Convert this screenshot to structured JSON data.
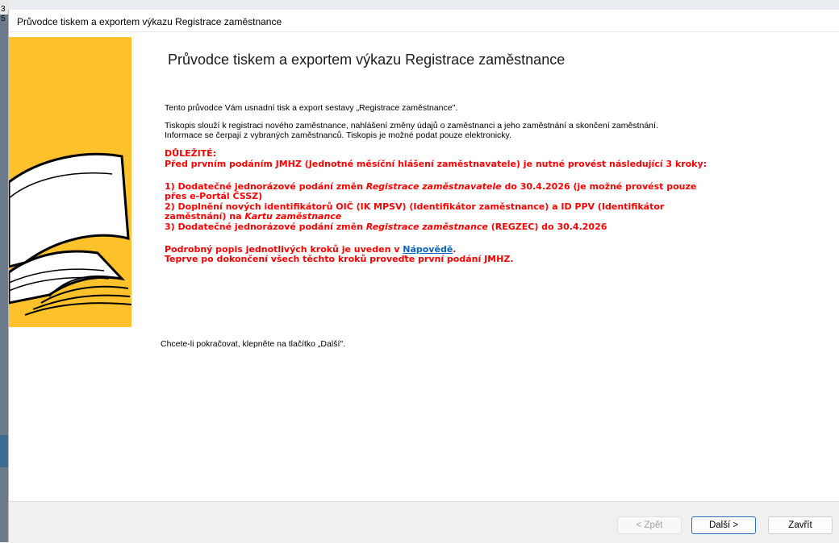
{
  "window": {
    "title": "Průvodce tiskem a exportem výkazu Registrace zaměstnance"
  },
  "background_chars": "3\n5",
  "wizard": {
    "heading": "Průvodce tiskem a exportem výkazu Registrace zaměstnance",
    "intro1": "Tento průvodce Vám usnadní tisk a export sestavy „Registrace zaměstnance\".",
    "intro2": "Tiskopis slouží k registraci nového zaměstnance, nahlášení změny údajů o zaměstnanci a jeho zaměstnání a skončení zaměstnání.",
    "intro3": "Informace se čerpají z vybraných zaměstnanců. Tiskopis je možné podat pouze elektronicky.",
    "important_label": "DŮLEŽITÉ:",
    "important_line": "Před prvním podáním JMHZ (Jednotné měsíční hlášení zaměstnavatele) je nutné provést následující 3 kroky:",
    "step1_a": "1) Dodatečné jednorázové podání změn ",
    "step1_italic": "Registrace zaměstnavatele",
    "step1_b": " do 30.4.2026 (je možné provést pouze",
    "step1_c": "přes e-Portál ČSSZ)",
    "step2_a": "2) Doplnění nových identifikátorů OIČ (IK MPSV) (Identifikátor zaměstnance) a ID PPV (Identifikátor",
    "step2_b": "zaměstnání) na ",
    "step2_italic": "Kartu zaměstnance",
    "step3_a": "3) Dodatečné jednorázové podání změn ",
    "step3_italic": "Registrace zaměstnance",
    "step3_b": " (REGZEC) do 30.4.2026",
    "help_a": "Podrobný popis jednotlivých kroků je uveden v ",
    "help_link": "Nápovědě",
    "help_b": ".",
    "final_line": "Teprve po dokončení všech těchto kroků proveďte první podání JMHZ.",
    "continue_text": "Chcete-li pokračovat, klepněte na tlačítko „Další\"."
  },
  "buttons": {
    "back": "< Zpět",
    "next": "Další >",
    "close": "Zavřít"
  },
  "colors": {
    "accent_yellow": "#fdc12c",
    "warning_red": "#ff0000",
    "link_blue": "#0563c1"
  }
}
